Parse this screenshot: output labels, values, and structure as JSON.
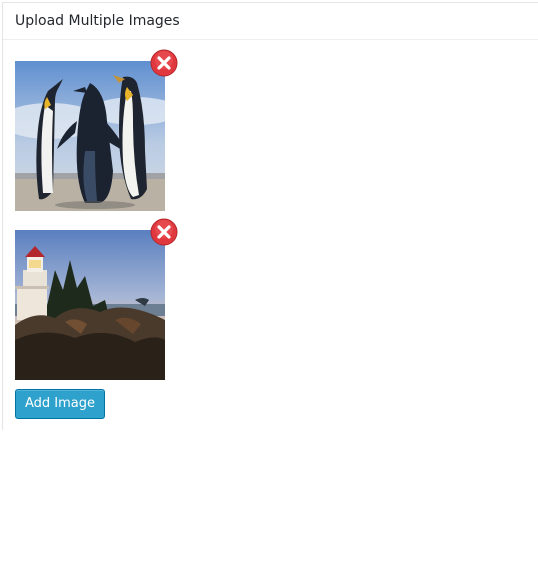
{
  "panel": {
    "title": "Upload Multiple Images"
  },
  "images": [
    {
      "subject": "penguins",
      "remove_icon": "remove-circle-x-icon"
    },
    {
      "subject": "lighthouse",
      "remove_icon": "remove-circle-x-icon"
    }
  ],
  "actions": {
    "add_image_label": "Add Image"
  },
  "colors": {
    "button_bg": "#2ea2cc",
    "button_border": "#0074a2",
    "remove_icon": "#e0383e"
  }
}
